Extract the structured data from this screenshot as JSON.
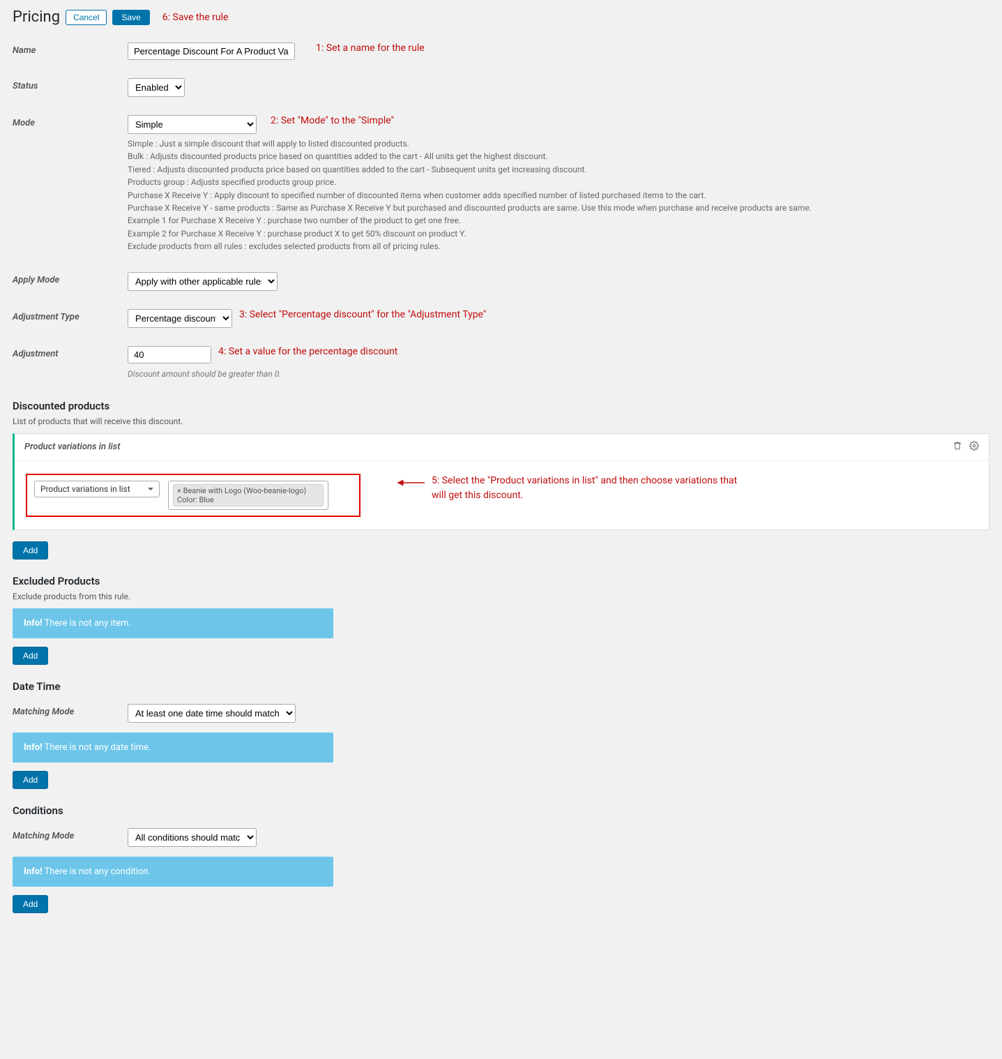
{
  "header": {
    "title": "Pricing",
    "cancel": "Cancel",
    "save": "Save",
    "anno6": "6: Save the rule"
  },
  "name": {
    "label": "Name",
    "value": "Percentage Discount For A Product Variation",
    "anno": "1: Set a name for the rule"
  },
  "status": {
    "label": "Status",
    "value": "Enabled"
  },
  "mode": {
    "label": "Mode",
    "value": "Simple",
    "anno": "2: Set \"Mode\" to the \"Simple\"",
    "help": [
      "Simple : Just a simple discount that will apply to listed discounted products.",
      "Bulk : Adjusts discounted products price based on quantities added to the cart - All units get the highest discount.",
      "Tiered : Adjusts discounted products price based on quantities added to the cart - Subsequent units get increasing discount.",
      "Products group : Adjusts specified products group price.",
      "Purchase X Receive Y : Apply discount to specified number of discounted items when customer adds specified number of listed purchased items to the cart.",
      "Purchase X Receive Y - same products : Same as Purchase X Receive Y but purchased and discounted products are same. Use this mode when purchase and receive products are same.",
      "Example 1 for Purchase X Receive Y : purchase two number of the product to get one free.",
      "Example 2 for Purchase X Receive Y : purchase product X to get 50% discount on product Y.",
      "Exclude products from all rules : excludes selected products from all of pricing rules."
    ]
  },
  "applyMode": {
    "label": "Apply Mode",
    "value": "Apply with other applicable rules"
  },
  "adjType": {
    "label": "Adjustment Type",
    "value": "Percentage discount",
    "anno": "3: Select \"Percentage discount\" for the \"Adjustment Type\""
  },
  "adjustment": {
    "label": "Adjustment",
    "value": "40",
    "anno": "4: Set a value for the percentage discount",
    "note": "Discount amount should be greater than 0."
  },
  "discounted": {
    "title": "Discounted products",
    "sub": "List of products that will receive this discount.",
    "panelTitle": "Product variations in list",
    "selectorLabel": "Product variations in list",
    "chip": "× Beanie with Logo (Woo-beanie-logo) Color: Blue",
    "anno": "5: Select the \"Product variations in list\" and then choose variations that will get this discount.",
    "add": "Add"
  },
  "excluded": {
    "title": "Excluded Products",
    "sub": "Exclude products from this rule.",
    "infoPrefix": "Info!",
    "infoText": " There is not any item.",
    "add": "Add"
  },
  "datetime": {
    "title": "Date Time",
    "matchLabel": "Matching Mode",
    "matchValue": "At least one date time should match",
    "infoPrefix": "Info!",
    "infoText": " There is not any date time.",
    "add": "Add"
  },
  "conditions": {
    "title": "Conditions",
    "matchLabel": "Matching Mode",
    "matchValue": "All conditions should match",
    "infoPrefix": "Info!",
    "infoText": " There is not any condition.",
    "add": "Add"
  }
}
